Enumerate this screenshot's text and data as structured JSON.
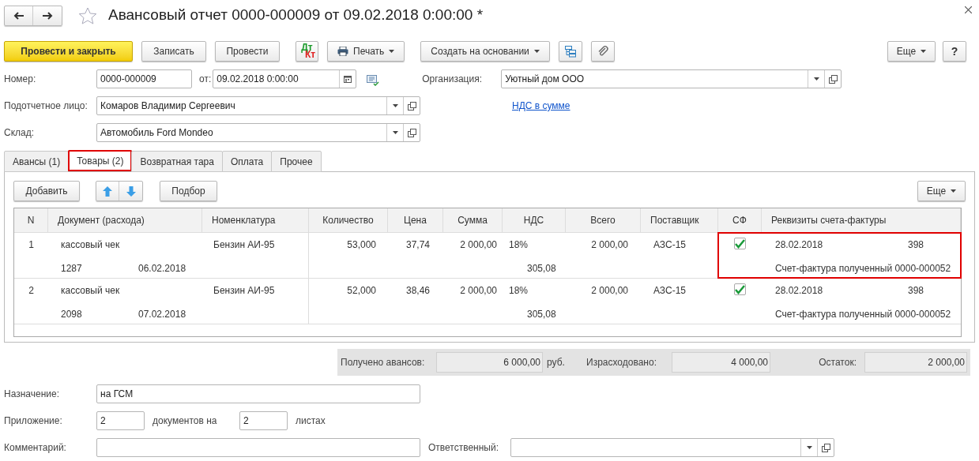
{
  "window": {
    "title": "Авансовый отчет 0000-000009 от 09.02.2018 0:00:00 *",
    "favorite": false
  },
  "toolbar": [
    {
      "kind": "primary",
      "label": "Провести и закрыть"
    },
    {
      "kind": "button",
      "label": "Записать"
    },
    {
      "kind": "button",
      "label": "Провести"
    },
    {
      "kind": "dtkt",
      "label": "Дт",
      "label2": "Кт"
    },
    {
      "kind": "print",
      "label": "Печать"
    },
    {
      "kind": "menu",
      "label": "Создать на основании"
    },
    {
      "kind": "structure"
    },
    {
      "kind": "attach"
    }
  ],
  "toolbar_right": [
    {
      "kind": "menu",
      "label": "Еще"
    },
    {
      "kind": "button",
      "label": "?"
    }
  ],
  "header": {
    "number_label": "Номер:",
    "number": "0000-000009",
    "date_label": "от:",
    "date": "09.02.2018  0:00:00",
    "org_label": "Организация:",
    "org": "Уютный дом ООО",
    "person_label": "Подотчетное лицо:",
    "person": "Комаров Владимир Сергеевич",
    "vat_link": "НДС в сумме",
    "warehouse_label": "Склад:",
    "warehouse": "Автомобиль Ford Mondeo"
  },
  "tabs": [
    {
      "label": "Авансы (1)",
      "selected": false,
      "highlighted": false
    },
    {
      "label": "Товары (2)",
      "selected": true,
      "highlighted": true
    },
    {
      "label": "Возвратная тара",
      "selected": false,
      "highlighted": false
    },
    {
      "label": "Оплата",
      "selected": false,
      "highlighted": false
    },
    {
      "label": "Прочее",
      "selected": false,
      "highlighted": false
    }
  ],
  "table_toolbar": {
    "add": "Добавить",
    "pick": "Подбор",
    "more": "Еще"
  },
  "table": {
    "columns": [
      "N",
      "Документ (расхода)",
      "Номенклатура",
      "Количество",
      "Цена",
      "Сумма",
      "НДС",
      "Всего",
      "Поставщик",
      "СФ",
      "Реквизиты счета-фактуры"
    ],
    "rows": [
      {
        "n": "1",
        "doc_type": "кассовый чек",
        "doc_number": "1287",
        "doc_date": "06.02.2018",
        "item": "Бензин АИ-95",
        "quantity": "53,000",
        "price": "37,74",
        "sum": "2 000,00",
        "vat_rate": "18%",
        "vat_amount": "305,08",
        "total": "2 000,00",
        "supplier": "АЗС-15",
        "invoice_checked": true,
        "invoice_date": "28.02.2018",
        "invoice_number": "398",
        "invoice_name": "Счет-фактура полученный 0000-000052",
        "highlighted": true
      },
      {
        "n": "2",
        "doc_type": "кассовый чек",
        "doc_number": "2098",
        "doc_date": "07.02.2018",
        "item": "Бензин АИ-95",
        "quantity": "52,000",
        "price": "38,46",
        "sum": "2 000,00",
        "vat_rate": "18%",
        "vat_amount": "305,08",
        "total": "2 000,00",
        "supplier": "АЗС-15",
        "invoice_checked": true,
        "invoice_date": "28.02.2018",
        "invoice_number": "398",
        "invoice_name": "Счет-фактура полученный 0000-000052",
        "highlighted": false
      }
    ]
  },
  "summary": {
    "received_label": "Получено авансов:",
    "received": "6 000,00",
    "currency": "руб.",
    "spent_label": "Израсходовано:",
    "spent": "4 000,00",
    "rest_label": "Остаток:",
    "rest": "2 000,00"
  },
  "footer": {
    "purpose_label": "Назначение:",
    "purpose": "на ГСМ",
    "attach_label": "Приложение:",
    "docs": "2",
    "docs_label": "документов на",
    "sheets": "2",
    "sheets_label": "листах",
    "comment_label": "Комментарий:",
    "responsible_label": "Ответственный:"
  }
}
